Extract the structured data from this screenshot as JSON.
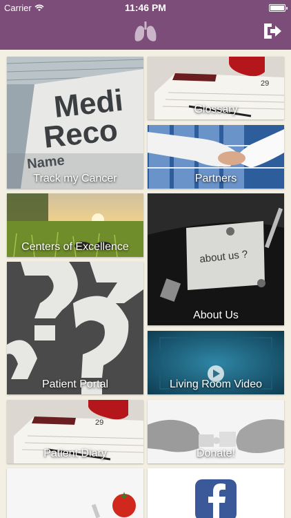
{
  "status": {
    "carrier": "Carrier",
    "time": "11:46 PM"
  },
  "navbar": {
    "logo_icon": "lungs-icon",
    "logout_icon": "logout-arrow-icon"
  },
  "tiles": {
    "track": "Track my Cancer",
    "glossary": "Glossary",
    "partners": "Partners",
    "centers": "Centers of Excellence",
    "about": "About Us",
    "about_sign": "about us ?",
    "portal": "Patient Portal",
    "video": "Living Room Video",
    "diary": "Patient Diary",
    "donate": "Donate!",
    "facebook_icon": "facebook-icon"
  },
  "colors": {
    "header": "#7b4d78",
    "background": "#f3efe2",
    "facebook": "#3b5998"
  }
}
